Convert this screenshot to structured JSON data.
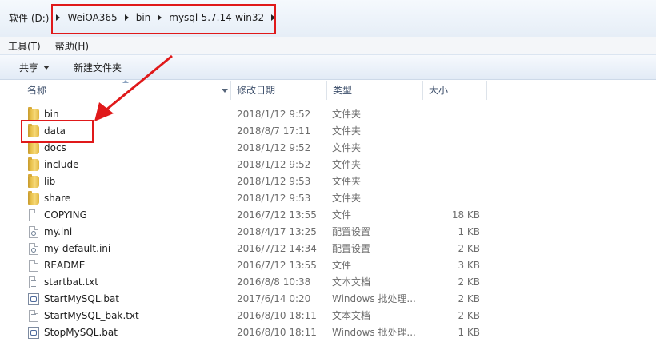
{
  "address_bar": {
    "crumbs": [
      "软件 (D:)",
      "WeiOA365",
      "bin",
      "mysql-5.7.14-win32"
    ]
  },
  "menubar": {
    "items": [
      "工具(T)",
      "帮助(H)"
    ]
  },
  "toolbar": {
    "share_label": "共享",
    "new_folder_label": "新建文件夹"
  },
  "columns": {
    "name": "名称",
    "date": "修改日期",
    "type": "类型",
    "size": "大小"
  },
  "files": [
    {
      "name": "bin",
      "date": "2018/1/12 9:52",
      "type": "文件夹",
      "size": "",
      "icon": "folder-icon"
    },
    {
      "name": "data",
      "date": "2018/8/7 17:11",
      "type": "文件夹",
      "size": "",
      "icon": "folder-icon"
    },
    {
      "name": "docs",
      "date": "2018/1/12 9:52",
      "type": "文件夹",
      "size": "",
      "icon": "folder-icon"
    },
    {
      "name": "include",
      "date": "2018/1/12 9:52",
      "type": "文件夹",
      "size": "",
      "icon": "folder-icon"
    },
    {
      "name": "lib",
      "date": "2018/1/12 9:53",
      "type": "文件夹",
      "size": "",
      "icon": "folder-icon"
    },
    {
      "name": "share",
      "date": "2018/1/12 9:53",
      "type": "文件夹",
      "size": "",
      "icon": "folder-icon"
    },
    {
      "name": "COPYING",
      "date": "2016/7/12 13:55",
      "type": "文件",
      "size": "18 KB",
      "icon": "file-icon"
    },
    {
      "name": "my.ini",
      "date": "2018/4/17 13:25",
      "type": "配置设置",
      "size": "1 KB",
      "icon": "settings-file-icon"
    },
    {
      "name": "my-default.ini",
      "date": "2016/7/12 14:34",
      "type": "配置设置",
      "size": "2 KB",
      "icon": "settings-file-icon"
    },
    {
      "name": "README",
      "date": "2016/7/12 13:55",
      "type": "文件",
      "size": "3 KB",
      "icon": "file-icon"
    },
    {
      "name": "startbat.txt",
      "date": "2016/8/8 10:38",
      "type": "文本文档",
      "size": "2 KB",
      "icon": "text-file-icon"
    },
    {
      "name": "StartMySQL.bat",
      "date": "2017/6/14 0:20",
      "type": "Windows 批处理...",
      "size": "2 KB",
      "icon": "batch-file-icon"
    },
    {
      "name": "StartMySQL_bak.txt",
      "date": "2016/8/10 18:11",
      "type": "文本文档",
      "size": "2 KB",
      "icon": "text-file-icon"
    },
    {
      "name": "StopMySQL.bat",
      "date": "2016/8/10 18:11",
      "type": "Windows 批处理...",
      "size": "1 KB",
      "icon": "batch-file-icon"
    }
  ],
  "colors": {
    "highlight_box": "#e0191a",
    "annotation_arrow": "#e0191a"
  }
}
